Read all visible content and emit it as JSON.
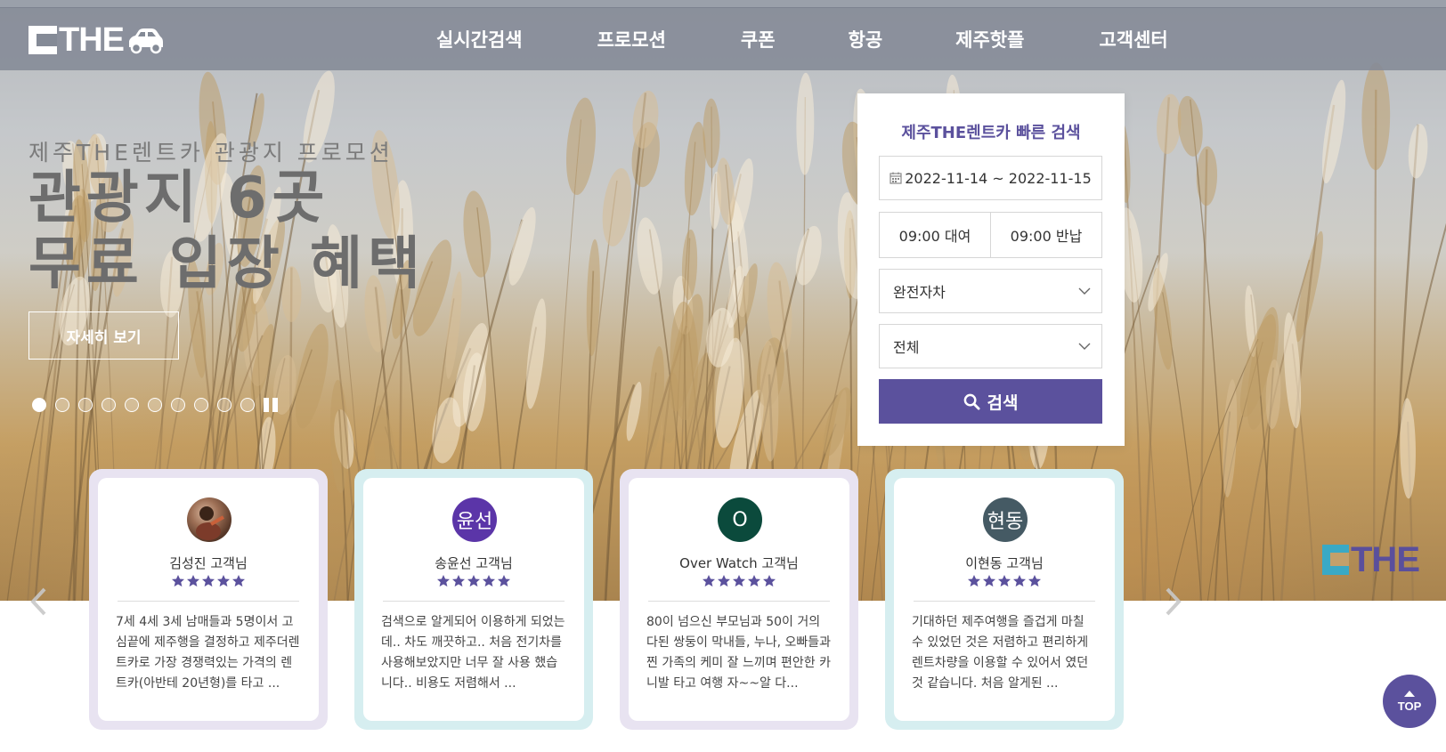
{
  "header": {
    "logo_text": "THE",
    "nav": [
      "실시간검색",
      "프로모션",
      "쿠폰",
      "항공",
      "제주핫플",
      "고객센터"
    ]
  },
  "hero": {
    "subtitle": "제주THE렌트카 관광지 프로모션",
    "title_line1": "관광지 6곳",
    "title_line2": "무료 입장 혜택",
    "detail_button": "자세히 보기",
    "slide_count": 10,
    "active_slide": 1
  },
  "search": {
    "title": "제주THE렌트카 빠른 검색",
    "date_range": "2022-11-14 ~ 2022-11-15",
    "pickup_time": "09:00 대여",
    "return_time": "09:00 반납",
    "insurance_select": "완전자차",
    "car_type_select": "전체",
    "search_button": "검색"
  },
  "watermark_logo": "THE",
  "reviews": [
    {
      "name": "김성진 고객님",
      "avatar_text": "",
      "avatar_color": "#6b4a3a",
      "stars": 5,
      "text": "7세 4세 3세 남매들과 5명이서 고심끝에 제주행을 결정하고 제주더렌트카로 가장 경쟁력있는 가격의 렌트카(아반테 20년형)를 타고 ..."
    },
    {
      "name": "송윤선 고객님",
      "avatar_text": "윤선",
      "avatar_color": "#5b35a8",
      "stars": 5,
      "text": "검색으로 알게되어 이용하게 되었는데.. 차도 깨끗하고.. 처음 전기차를 사용해보았지만 너무 잘 사용 했습니다.. 비용도 저렴해서 ..."
    },
    {
      "name": "Over Watch 고객님",
      "avatar_text": "O",
      "avatar_color": "#0b4a3c",
      "stars": 5,
      "text": "80이 넘으신 부모님과 50이 거의 다된 쌍둥이 막내들, 누나, 오빠들과 찐 가족의 케미 잘 느끼며 편안한 카니발 타고 여행 자~~알 다..."
    },
    {
      "name": "이현동 고객님",
      "avatar_text": "현동",
      "avatar_color": "#455a64",
      "stars": 5,
      "text": "기대하던 제주여행을 즐겁게 마칠 수 있었던 것은 저렴하고 편리하게 렌트차량을 이용할 수 있어서 였던것 같습니다. 처음 알게된 ..."
    }
  ],
  "top_button": "TOP",
  "colors": {
    "brand_purple": "#5b519d",
    "header_gray": "#848a96",
    "card_lavender": "#e8e3f1",
    "card_cyan": "#d6eef0",
    "star": "#5b519d"
  },
  "icons": [
    "calendar-icon",
    "chevron-down-icon",
    "search-icon",
    "star-icon",
    "arrow-left-icon",
    "arrow-right-icon",
    "caret-up-icon",
    "car-icon"
  ]
}
